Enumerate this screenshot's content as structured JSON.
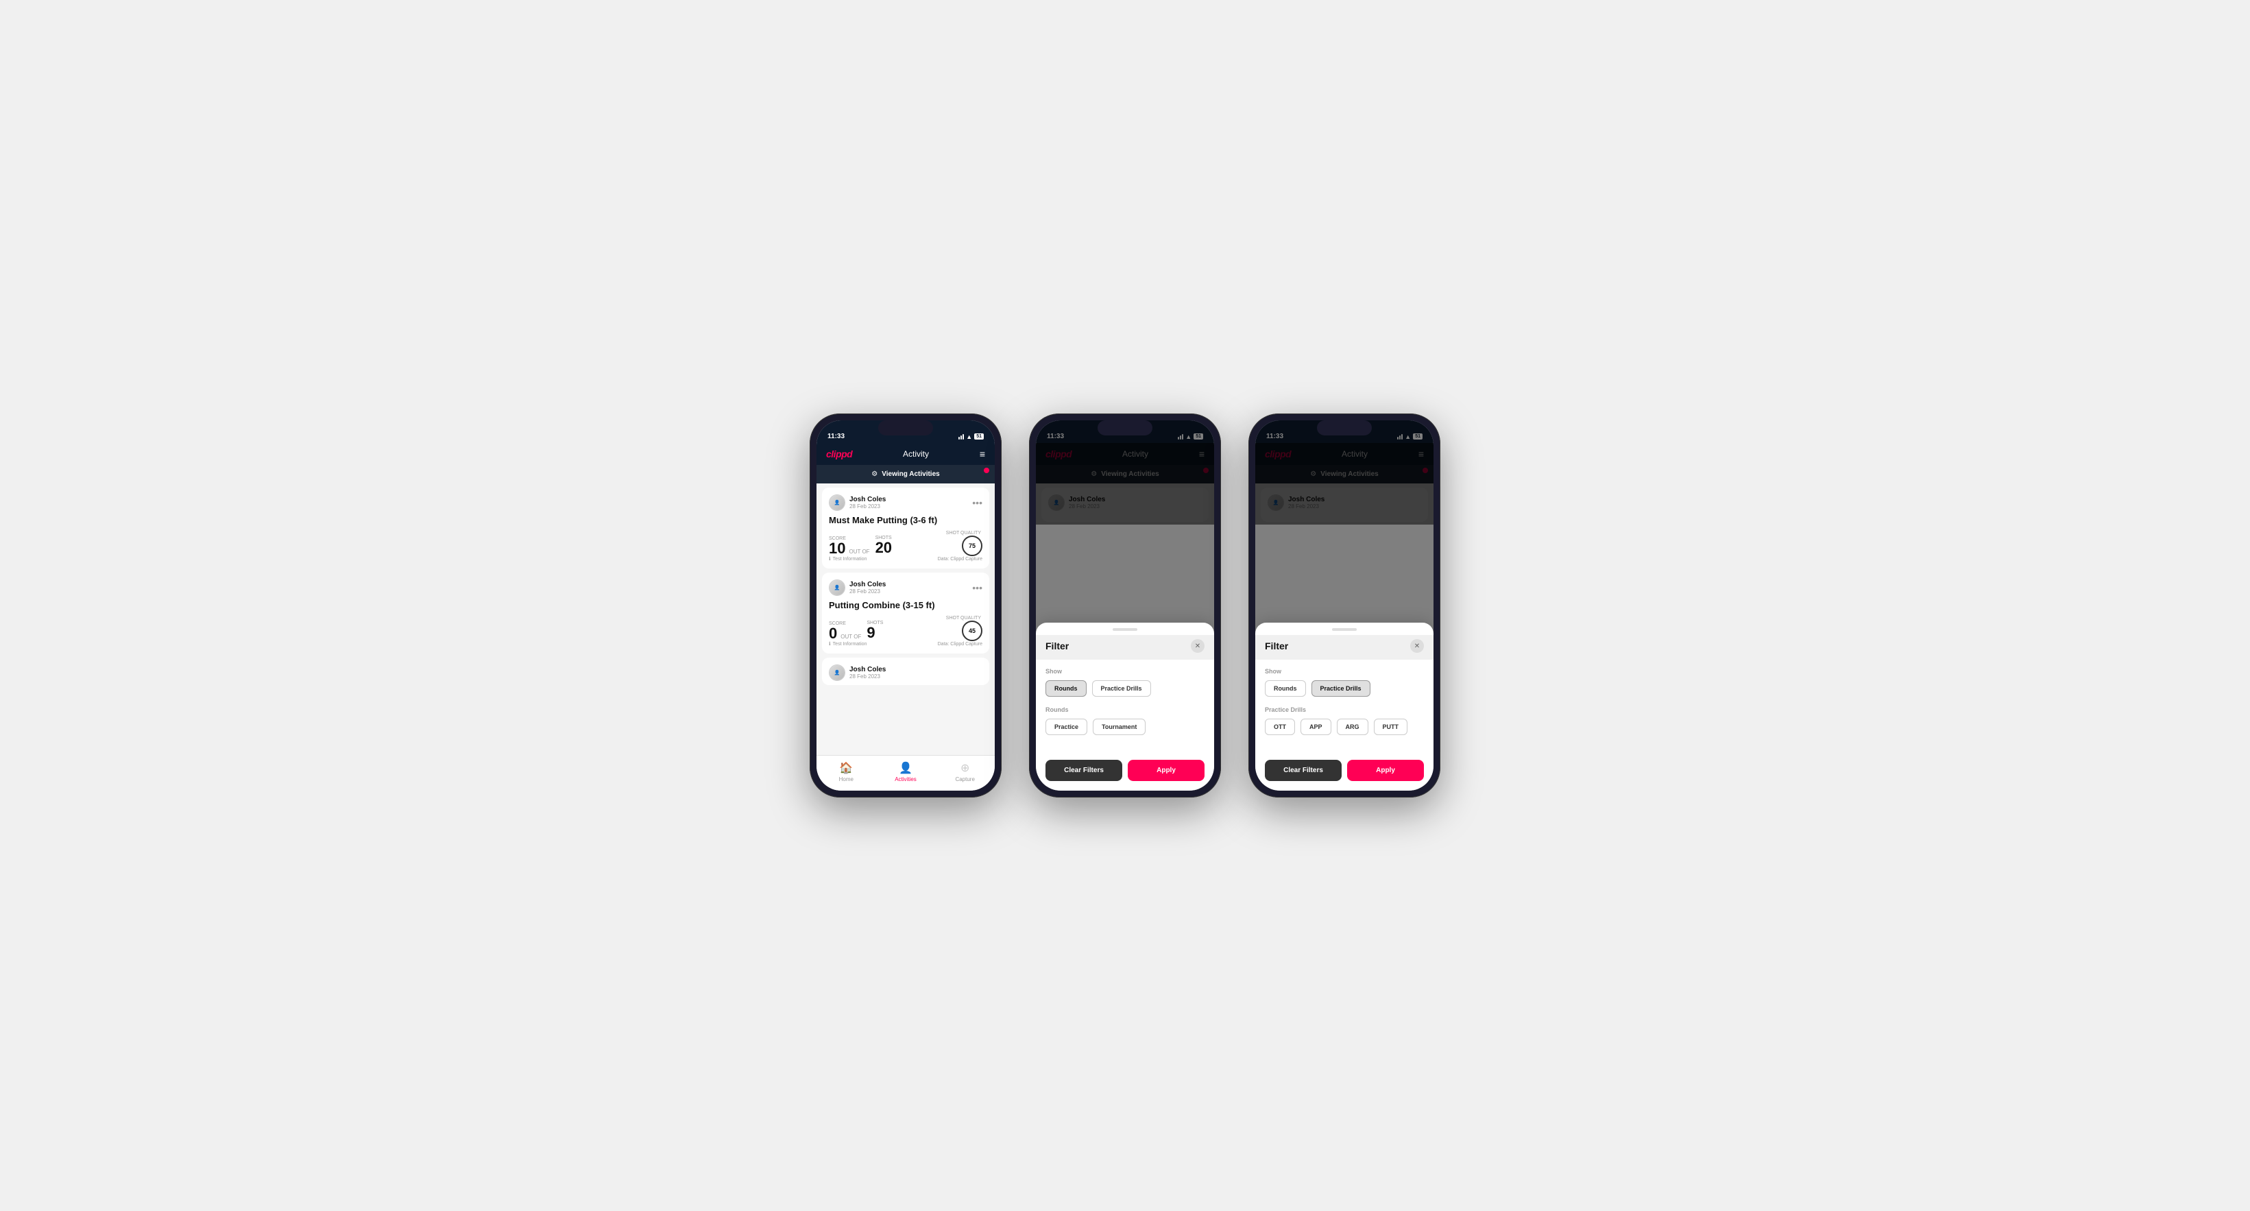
{
  "app": {
    "logo": "clippd",
    "nav_title": "Activity",
    "time": "11:33",
    "battery": "51"
  },
  "viewing_banner": {
    "text": "Viewing Activities",
    "filter_icon": "⚙"
  },
  "phone1": {
    "cards": [
      {
        "user_name": "Josh Coles",
        "user_date": "28 Feb 2023",
        "activity_title": "Must Make Putting (3-6 ft)",
        "score_label": "Score",
        "score_value": "10",
        "shots_label": "Shots",
        "shots_value": "20",
        "shot_quality_label": "Shot Quality",
        "shot_quality_value": "75",
        "test_info": "Test Information",
        "data_source": "Data: Clippd Capture"
      },
      {
        "user_name": "Josh Coles",
        "user_date": "28 Feb 2023",
        "activity_title": "Putting Combine (3-15 ft)",
        "score_label": "Score",
        "score_value": "0",
        "shots_label": "Shots",
        "shots_value": "9",
        "shot_quality_label": "Shot Quality",
        "shot_quality_value": "45",
        "test_info": "Test Information",
        "data_source": "Data: Clippd Capture"
      },
      {
        "user_name": "Josh Coles",
        "user_date": "28 Feb 2023",
        "activity_title": "",
        "score_label": "",
        "score_value": "",
        "shots_label": "",
        "shots_value": "",
        "shot_quality_label": "",
        "shot_quality_value": "",
        "test_info": "",
        "data_source": ""
      }
    ]
  },
  "tabs": [
    {
      "label": "Home",
      "icon": "🏠",
      "active": false
    },
    {
      "label": "Activities",
      "icon": "👤",
      "active": true
    },
    {
      "label": "Capture",
      "icon": "⊕",
      "active": false
    }
  ],
  "filter_phone2": {
    "title": "Filter",
    "show_label": "Show",
    "show_buttons": [
      {
        "label": "Rounds",
        "active": true
      },
      {
        "label": "Practice Drills",
        "active": false
      }
    ],
    "rounds_label": "Rounds",
    "rounds_buttons": [
      {
        "label": "Practice",
        "active": false
      },
      {
        "label": "Tournament",
        "active": false
      }
    ],
    "clear_label": "Clear Filters",
    "apply_label": "Apply"
  },
  "filter_phone3": {
    "title": "Filter",
    "show_label": "Show",
    "show_buttons": [
      {
        "label": "Rounds",
        "active": false
      },
      {
        "label": "Practice Drills",
        "active": true
      }
    ],
    "drills_label": "Practice Drills",
    "drills_buttons": [
      {
        "label": "OTT",
        "active": false
      },
      {
        "label": "APP",
        "active": false
      },
      {
        "label": "ARG",
        "active": false
      },
      {
        "label": "PUTT",
        "active": false
      }
    ],
    "clear_label": "Clear Filters",
    "apply_label": "Apply"
  }
}
